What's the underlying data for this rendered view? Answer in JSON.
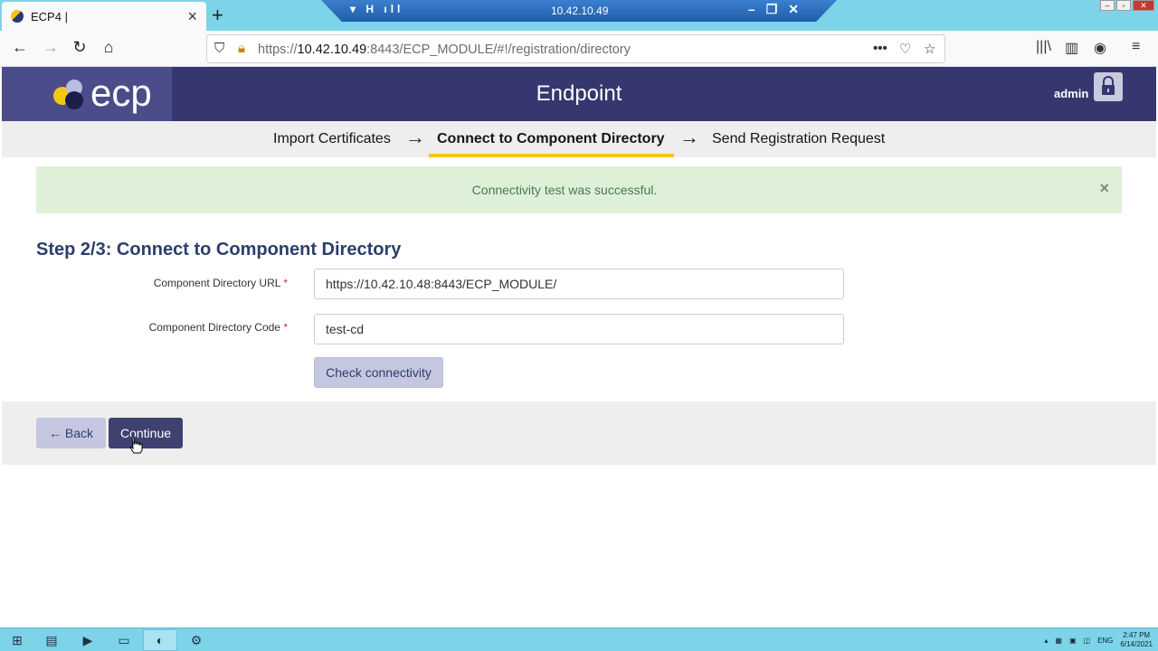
{
  "browser": {
    "tab_title": "ECP4 |",
    "tab_close": "×",
    "new_tab": "+",
    "rdp_ip": "10.42.10.49",
    "url_prefix": "https://",
    "url_host": "10.42.10.49",
    "url_rest": ":8443/ECP_MODULE/#!/registration/directory"
  },
  "header": {
    "logo_text": "ecp",
    "title": "Endpoint",
    "user": "admin"
  },
  "stepper": {
    "steps": [
      {
        "label": "Import Certificates"
      },
      {
        "label": "Connect to Component Directory"
      },
      {
        "label": "Send Registration Request"
      }
    ],
    "active_index": 1
  },
  "alert": {
    "message": "Connectivity test was successful.",
    "close": "×"
  },
  "form": {
    "heading": "Step 2/3: Connect to Component Directory",
    "url_label": "Component Directory URL",
    "url_value": "https://10.42.10.48:8443/ECP_MODULE/",
    "code_label": "Component Directory Code",
    "code_value": "test-cd",
    "required_mark": "*",
    "check_button": "Check connectivity"
  },
  "actions": {
    "back": "Back",
    "continue": "Continue"
  },
  "taskbar": {
    "lang": "ENG",
    "time": "2:47 PM",
    "date": "6/14/2021"
  },
  "colors": {
    "header_bg": "#36376f",
    "accent_yellow": "#f3c813",
    "success_bg": "#dff0d8",
    "primary_button": "#3f416f"
  }
}
